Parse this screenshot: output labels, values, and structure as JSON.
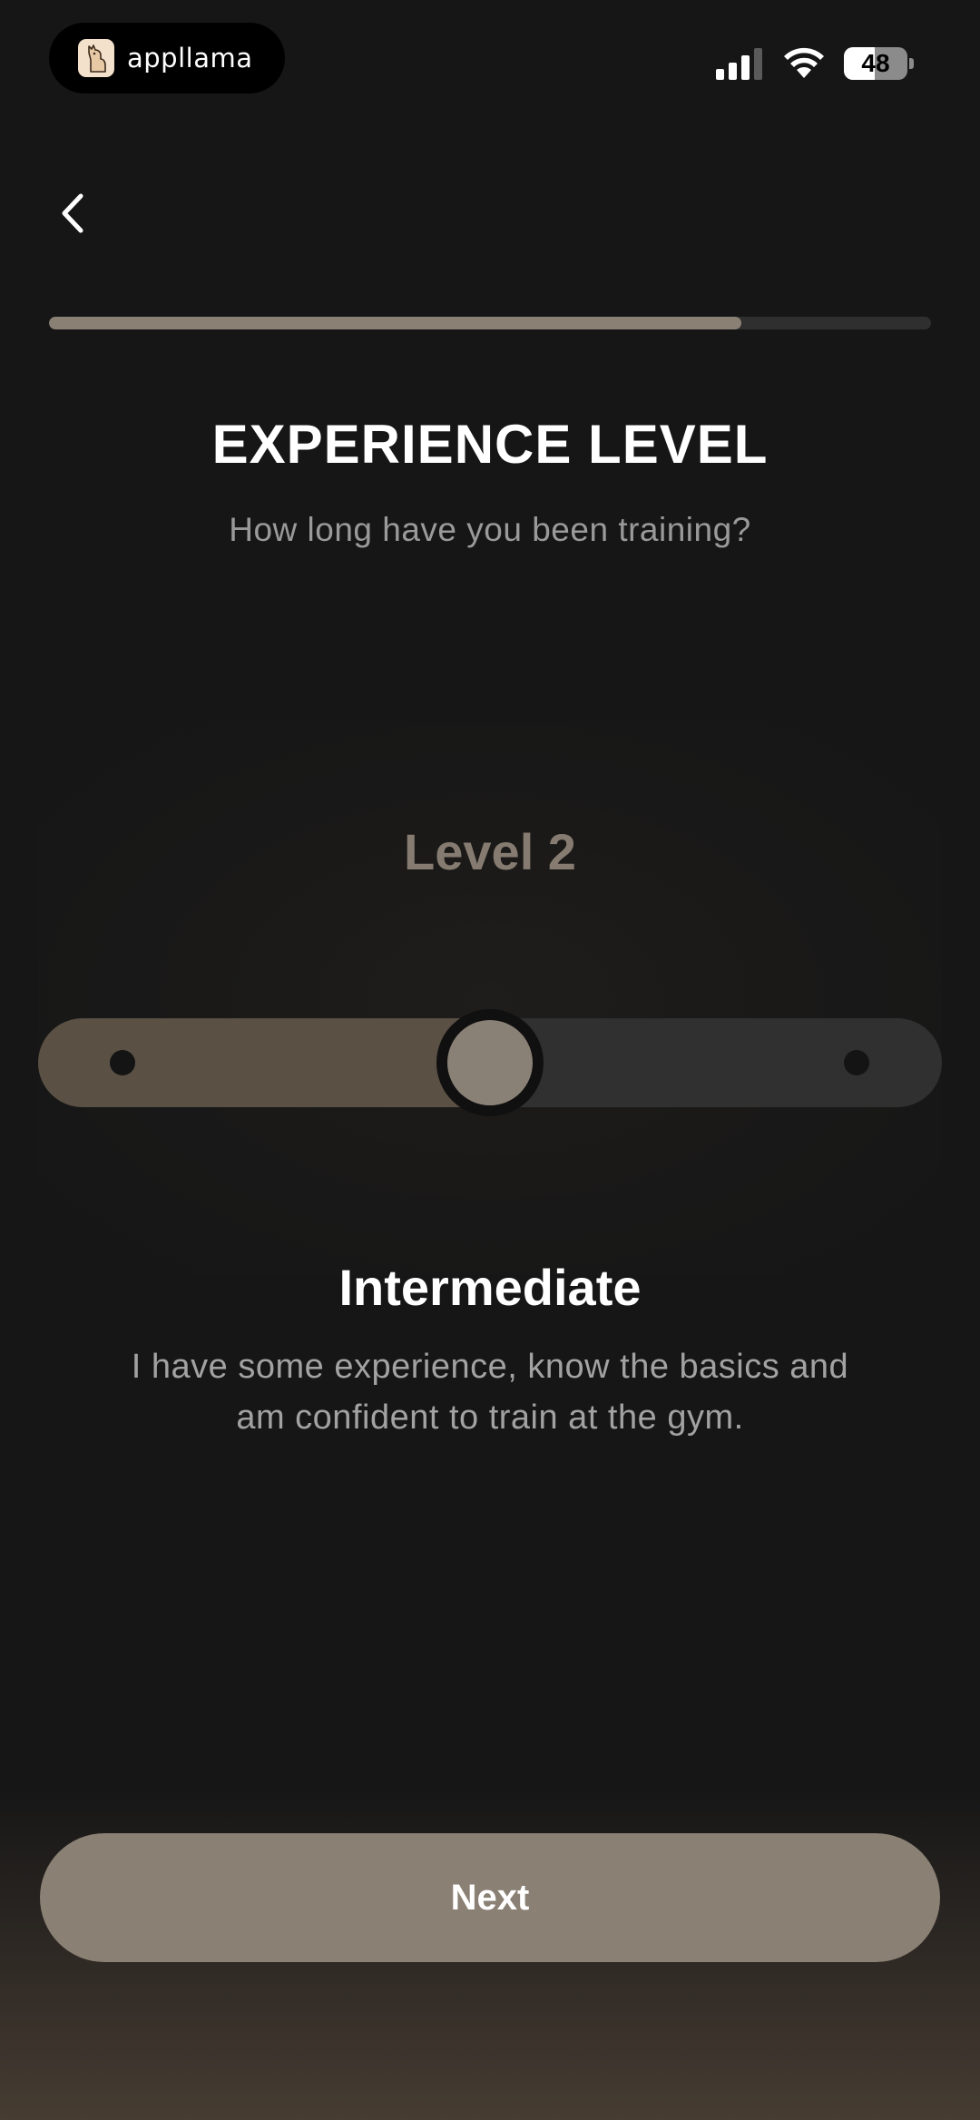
{
  "status_bar": {
    "app_name": "appllama",
    "battery_level": "48",
    "battery_fraction": 0.48
  },
  "progress": {
    "fraction": 0.785
  },
  "header": {
    "title": "EXPERIENCE LEVEL",
    "subtitle": "How long have you been training?"
  },
  "slider": {
    "level_label": "Level 2",
    "current_level": 2,
    "min_level": 1,
    "max_level": 3
  },
  "selection": {
    "name": "Intermediate",
    "description": "I have some experience, know the basics and am confident to train at the gym."
  },
  "footer": {
    "next_label": "Next"
  },
  "colors": {
    "background": "#161616",
    "accent": "#8a8074",
    "accent_dark": "#5a5044",
    "track": "#303030"
  },
  "icons": {
    "back": "chevron-left-icon",
    "signal": "signal-bars-icon",
    "wifi": "wifi-icon",
    "logo": "llama-logo-icon"
  }
}
